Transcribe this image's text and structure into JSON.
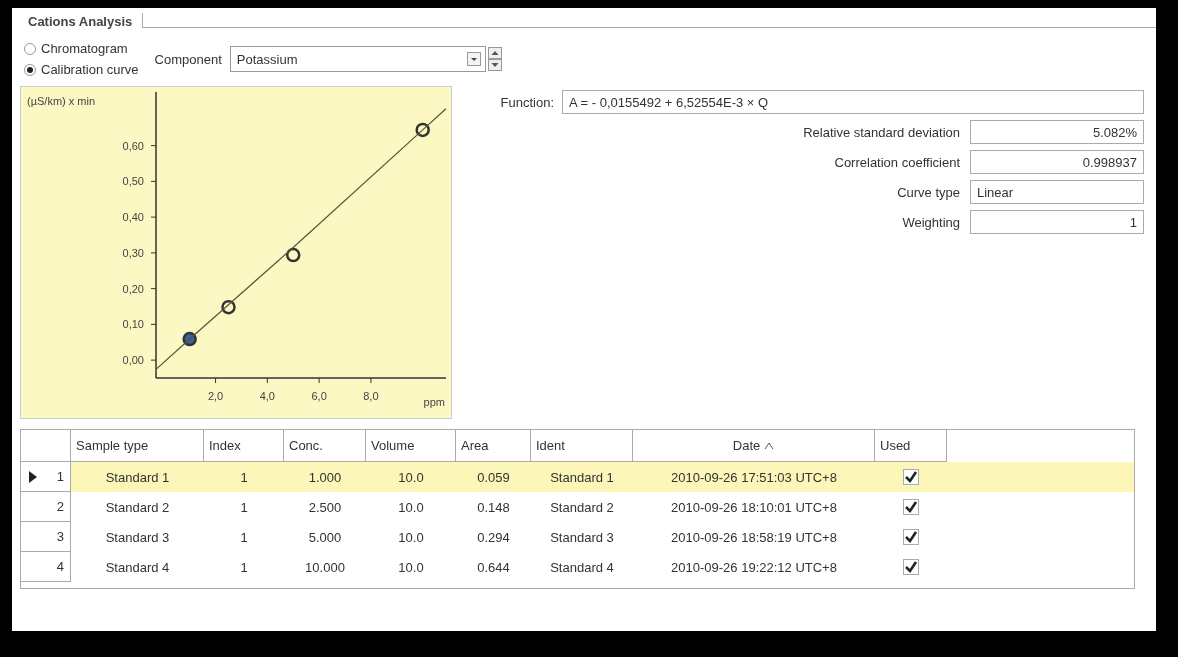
{
  "tab": {
    "title": "Cations Analysis"
  },
  "view_options": [
    {
      "label": "Chromatogram",
      "selected": false
    },
    {
      "label": "Calibration curve",
      "selected": true
    }
  ],
  "component": {
    "label": "Component",
    "value": "Potassium"
  },
  "chart": {
    "chart_data": {
      "type": "scatter",
      "ylabel": "(µS/km) x min",
      "xlabel": "ppm",
      "x": [
        -0.3,
        1.0,
        2.5,
        5.0,
        10.0,
        10.9
      ],
      "series": [
        {
          "color": "#333333",
          "values": [
            null,
            0.059,
            0.148,
            0.294,
            0.644,
            null
          ]
        },
        {
          "type": "line",
          "color": "#555533",
          "values": [
            -0.026,
            0.059,
            0.155,
            0.315,
            0.644,
            0.703
          ]
        }
      ],
      "xlim": [
        -0.3,
        10.9
      ],
      "ylim": [
        -0.05,
        0.75
      ],
      "xticks": [
        {
          "value": 2,
          "label": "2,0"
        },
        {
          "value": 4,
          "label": "4,0"
        },
        {
          "value": 6,
          "label": "6,0"
        },
        {
          "value": 8,
          "label": "8,0"
        }
      ],
      "yticks": [
        {
          "value": 0,
          "label": "0,00"
        },
        {
          "value": 0.1,
          "label": "0,10"
        },
        {
          "value": 0.2,
          "label": "0,20"
        },
        {
          "value": 0.3,
          "label": "0,30"
        },
        {
          "value": 0.4,
          "label": "0,40"
        },
        {
          "value": 0.5,
          "label": "0,50"
        },
        {
          "value": 0.6,
          "label": "0,60"
        }
      ]
    }
  },
  "function": {
    "label": "Function:",
    "value": "A = - 0,0155492 + 6,52554E-3 × Q"
  },
  "stats": [
    {
      "label": "Relative standard deviation",
      "value": "5.082%",
      "kind": "number"
    },
    {
      "label": "Correlation coefficient",
      "value": "0.998937",
      "kind": "number"
    },
    {
      "label": "Curve type",
      "value": "Linear",
      "kind": "text"
    },
    {
      "label": "Weighting",
      "value": "1",
      "kind": "number"
    }
  ],
  "table": {
    "columns": [
      {
        "label": "Sample type",
        "sorted": false
      },
      {
        "label": "Index",
        "sorted": false
      },
      {
        "label": "Conc.",
        "sorted": false
      },
      {
        "label": "Volume",
        "sorted": false
      },
      {
        "label": "Area",
        "sorted": false
      },
      {
        "label": "Ident",
        "sorted": false
      },
      {
        "label": "Date",
        "sorted": true
      },
      {
        "label": "Used",
        "sorted": false
      }
    ],
    "rows": [
      {
        "number": "1",
        "selected": true,
        "cells": [
          "Standard 1",
          "1",
          "1.000",
          "10.0",
          "0.059",
          "Standard 1",
          "2010-09-26 17:51:03 UTC+8"
        ],
        "used": true
      },
      {
        "number": "2",
        "selected": false,
        "cells": [
          "Standard 2",
          "1",
          "2.500",
          "10.0",
          "0.148",
          "Standard 2",
          "2010-09-26 18:10:01 UTC+8"
        ],
        "used": true
      },
      {
        "number": "3",
        "selected": false,
        "cells": [
          "Standard 3",
          "1",
          "5.000",
          "10.0",
          "0.294",
          "Standard 3",
          "2010-09-26 18:58:19 UTC+8"
        ],
        "used": true
      },
      {
        "number": "4",
        "selected": false,
        "cells": [
          "Standard 4",
          "1",
          "10.000",
          "10.0",
          "0.644",
          "Standard 4",
          "2010-09-26 19:22:12 UTC+8"
        ],
        "used": true
      }
    ]
  }
}
